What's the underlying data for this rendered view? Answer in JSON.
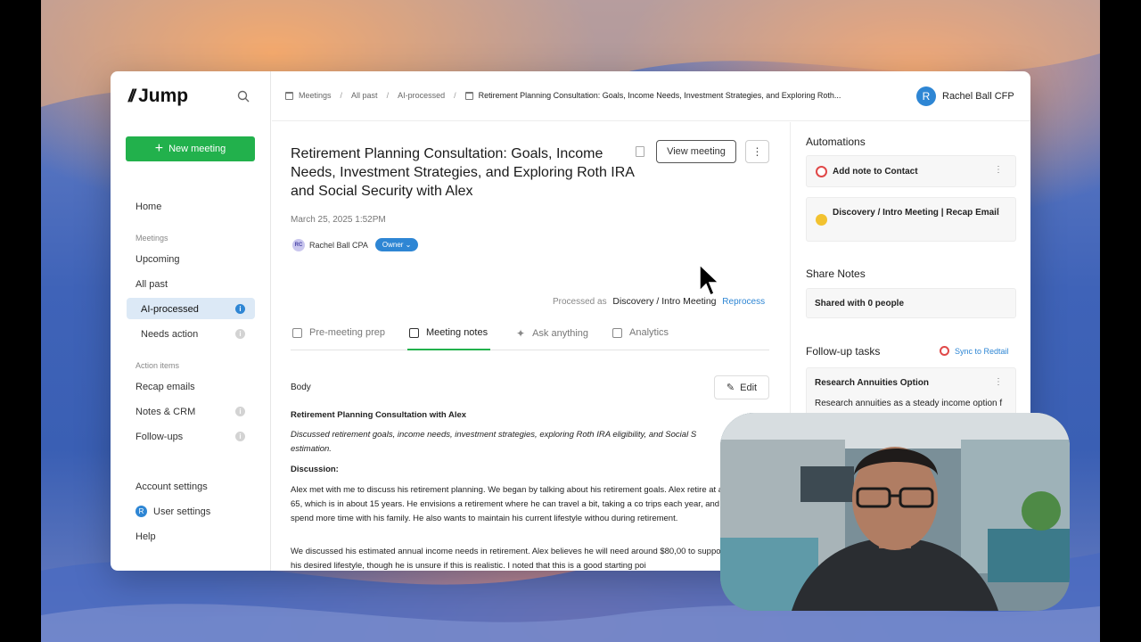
{
  "app": {
    "logo_text": "Jump"
  },
  "sidebar": {
    "new_meeting": "New meeting",
    "items": [
      {
        "label": "Home"
      },
      {
        "section": "Meetings"
      },
      {
        "label": "Upcoming"
      },
      {
        "label": "All past"
      },
      {
        "label": "AI-processed"
      },
      {
        "label": "Needs action"
      },
      {
        "section": "Action items"
      },
      {
        "label": "Recap emails"
      },
      {
        "label": "Notes & CRM"
      },
      {
        "label": "Follow-ups"
      },
      {
        "label": "Account settings"
      },
      {
        "label": "User settings",
        "avatar": "R"
      },
      {
        "label": "Help"
      }
    ]
  },
  "breadcrumb": {
    "items": [
      "Meetings",
      "All past",
      "AI-processed"
    ],
    "current": "Retirement Planning Consultation: Goals, Income Needs, Investment Strategies, and Exploring Roth..."
  },
  "user": {
    "initial": "R",
    "name": "Rachel Ball CFP"
  },
  "meeting": {
    "title": "Retirement Planning Consultation: Goals, Income Needs, Investment Strategies, and Exploring Roth IRA and Social Security with Alex",
    "view_button": "View meeting",
    "more_button": "⋮",
    "date": "March 25, 2025 1:52PM",
    "owner_initials": "RC",
    "owner_name": "Rachel Ball CPA",
    "owner_badge": "Owner ⌄",
    "processed_label": "Processed as",
    "processed_value": "Discovery / Intro Meeting",
    "reprocess": "Reprocess"
  },
  "tabs": [
    {
      "label": "Pre-meeting prep"
    },
    {
      "label": "Meeting notes"
    },
    {
      "label": "Ask anything"
    },
    {
      "label": "Analytics"
    }
  ],
  "notes": {
    "body_label": "Body",
    "edit_label": "Edit",
    "heading": "Retirement Planning Consultation with Alex",
    "summary": "Discussed retirement goals, income needs, investment strategies, exploring Roth IRA eligibility, and Social S estimation.",
    "discussion_label": "Discussion:",
    "para1": "Alex met with me to discuss his retirement planning. We began by talking about his retirement goals. Alex retire at age 65, which is in about 15 years. He envisions a retirement where he can travel a bit, taking a co trips each year, and spend more time with his family. He also wants to maintain his current lifestyle withou during retirement.",
    "para2": "We discussed his estimated annual income needs in retirement. Alex believes he will need around $80,00 to support his desired lifestyle, though he is unsure if this is realistic. I noted that this is a good starting poi"
  },
  "right_panel": {
    "automations_title": "Automations",
    "automations": [
      {
        "label": "Add note to Contact",
        "icon": "redtail-icon",
        "color": "#e04848"
      },
      {
        "label": "Discovery / Intro Meeting | Recap Email",
        "icon": "email-icon",
        "color": "#f2c230"
      }
    ],
    "share_title": "Share Notes",
    "share_value": "Shared with 0 people",
    "followup_title": "Follow-up tasks",
    "sync_label": "Sync to Redtail",
    "task_title": "Research Annuities Option",
    "task_text": "Research annuities as a steady income option f"
  },
  "colors": {
    "accent": "#22b14c",
    "link": "#2e86d4",
    "active_bg": "#dce9f6"
  }
}
